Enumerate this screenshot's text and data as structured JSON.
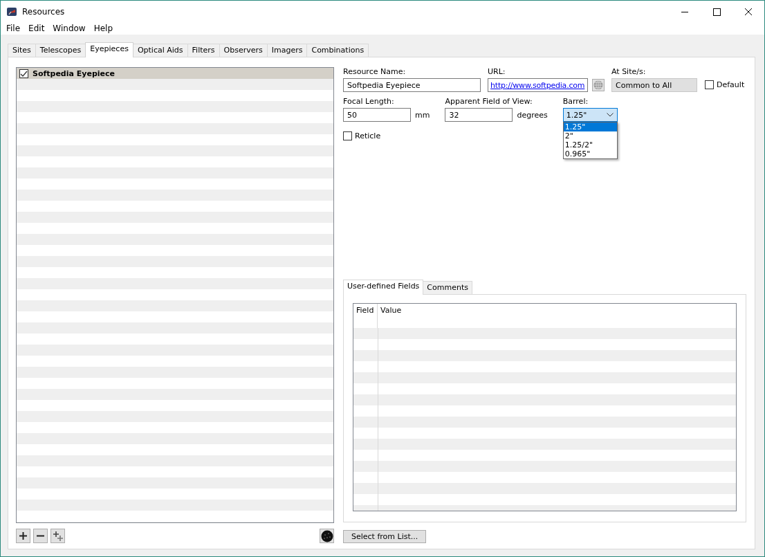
{
  "window": {
    "title": "Resources"
  },
  "menu": [
    "File",
    "Edit",
    "Window",
    "Help"
  ],
  "tabs": [
    {
      "label": "Sites",
      "selected": false
    },
    {
      "label": "Telescopes",
      "selected": false
    },
    {
      "label": "Eyepieces",
      "selected": true
    },
    {
      "label": "Optical Aids",
      "selected": false
    },
    {
      "label": "Filters",
      "selected": false
    },
    {
      "label": "Observers",
      "selected": false
    },
    {
      "label": "Imagers",
      "selected": false
    },
    {
      "label": "Combinations",
      "selected": false
    }
  ],
  "resources": [
    {
      "label": "Softpedia Eyepiece",
      "checked": true,
      "selected": true
    }
  ],
  "form": {
    "resource_name": {
      "label": "Resource Name:",
      "value": "Softpedia Eyepiece"
    },
    "url": {
      "label": "URL:",
      "value": "http://www.softpedia.com"
    },
    "at_sites": {
      "label": "At Site/s:",
      "value": "Common to All"
    },
    "default": {
      "label": "Default",
      "checked": false
    },
    "focal_length": {
      "label": "Focal Length:",
      "value": "50",
      "unit": "mm"
    },
    "apparent_fov": {
      "label": "Apparent Field of View:",
      "value": "32",
      "unit": "degrees"
    },
    "barrel": {
      "label": "Barrel:",
      "value": "1.25\"",
      "expanded": true,
      "options": [
        {
          "label": "1.25\"",
          "selected": true
        },
        {
          "label": "2\"",
          "selected": false
        },
        {
          "label": "1.25/2\"",
          "selected": false
        },
        {
          "label": "0.965\"",
          "selected": false
        }
      ]
    },
    "reticle": {
      "label": "Reticle",
      "checked": false
    }
  },
  "sub_tabs": [
    {
      "label": "User-defined Fields",
      "selected": true
    },
    {
      "label": "Comments",
      "selected": false
    }
  ],
  "table": {
    "columns": [
      "Field",
      "Value"
    ]
  },
  "select_button": "Select from List..."
}
